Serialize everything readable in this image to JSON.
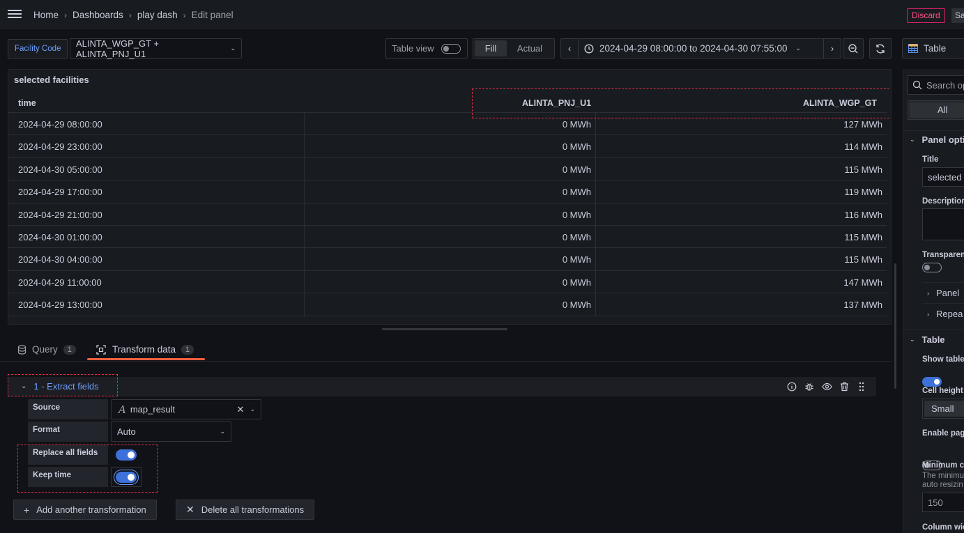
{
  "header": {
    "breadcrumb": [
      "Home",
      "Dashboards",
      "play dash",
      "Edit panel"
    ],
    "discard_label": "Discard",
    "save_label": "Sa"
  },
  "toolbar": {
    "facility_label": "Facility Code",
    "facility_value": "ALINTA_WGP_GT + ALINTA_PNJ_U1",
    "table_view_label": "Table view",
    "table_view_on": false,
    "fill_label": "Fill",
    "actual_label": "Actual",
    "time_range": "2024-04-29 08:00:00 to 2024-04-30 07:55:00",
    "visualization": "Table"
  },
  "panel": {
    "title": "selected facilities",
    "columns": [
      "time",
      "ALINTA_PNJ_U1",
      "ALINTA_WGP_GT"
    ],
    "rows": [
      [
        "2024-04-29 08:00:00",
        "0 MWh",
        "127 MWh"
      ],
      [
        "2024-04-29 23:00:00",
        "0 MWh",
        "114 MWh"
      ],
      [
        "2024-04-30 05:00:00",
        "0 MWh",
        "115 MWh"
      ],
      [
        "2024-04-29 17:00:00",
        "0 MWh",
        "119 MWh"
      ],
      [
        "2024-04-29 21:00:00",
        "0 MWh",
        "116 MWh"
      ],
      [
        "2024-04-30 01:00:00",
        "0 MWh",
        "115 MWh"
      ],
      [
        "2024-04-30 04:00:00",
        "0 MWh",
        "115 MWh"
      ],
      [
        "2024-04-29 11:00:00",
        "0 MWh",
        "147 MWh"
      ],
      [
        "2024-04-29 13:00:00",
        "0 MWh",
        "137 MWh"
      ]
    ]
  },
  "tabs": [
    {
      "label": "Query",
      "count": "1"
    },
    {
      "label": "Transform data",
      "count": "1"
    }
  ],
  "transform": {
    "title": "1 - Extract fields",
    "source_label": "Source",
    "source_value": "map_result",
    "format_label": "Format",
    "format_value": "Auto",
    "replace_label": "Replace all fields",
    "replace_on": true,
    "keep_time_label": "Keep time",
    "keep_time_on": true,
    "add_label": "Add another transformation",
    "delete_label": "Delete all transformations"
  },
  "options": {
    "search_placeholder": "Search op",
    "all_label": "All",
    "panel_options": "Panel opti",
    "title_label": "Title",
    "title_value": "selected",
    "description_label": "Description",
    "transparent_label": "Transparen",
    "panel_links": "Panel",
    "repeat": "Repea",
    "table_section": "Table",
    "show_table_header": "Show table",
    "cell_height_label": "Cell height",
    "cell_height_value": "Small",
    "enable_pagination": "Enable pag",
    "minimum_column": "Minimum co",
    "minimum_desc_1": "The minimu",
    "minimum_desc_2": "auto resizin",
    "minimum_value": "150",
    "column_width": "Column wic"
  },
  "colors": {
    "accent": "#3d71d9",
    "link": "#6e9fff",
    "danger": "#e02f44",
    "tab_active": "#f55f3e"
  }
}
